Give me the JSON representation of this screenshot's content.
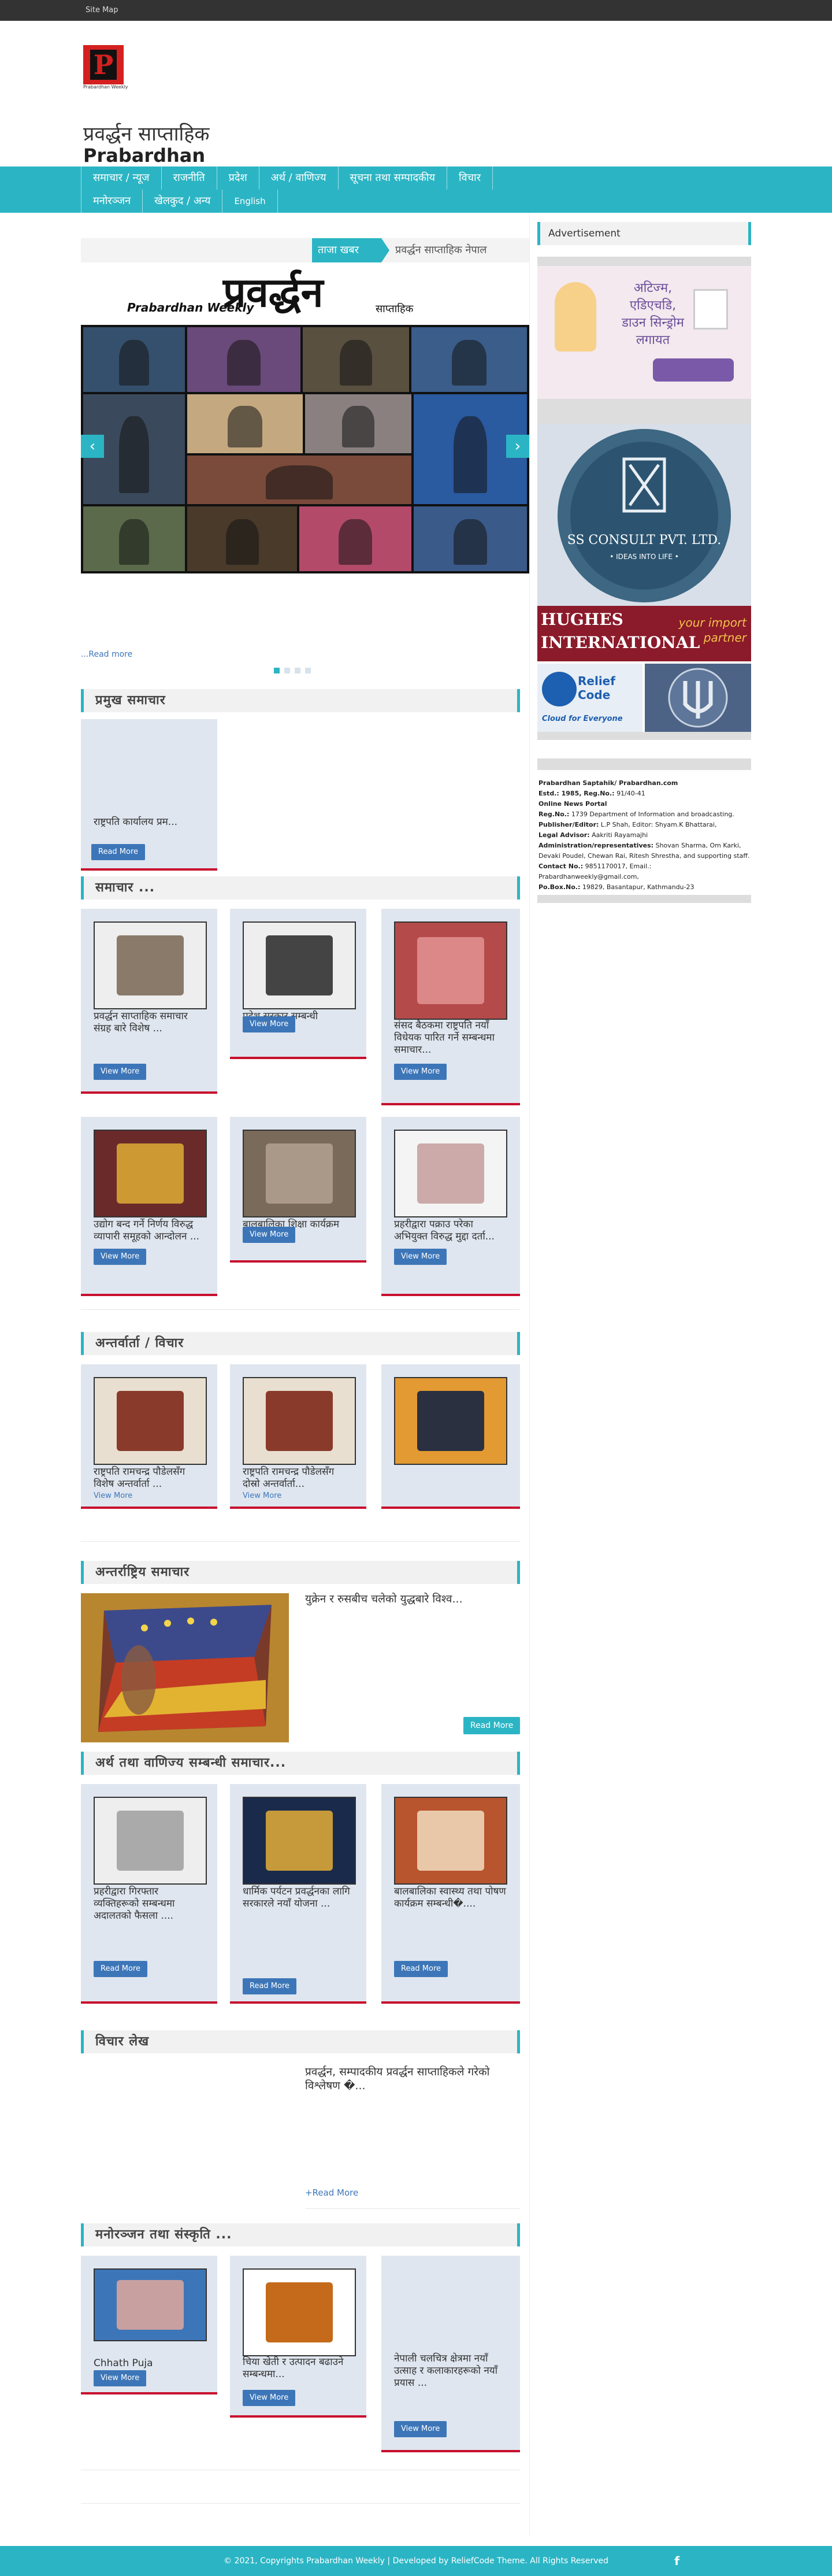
{
  "topbar": {
    "sitemap": "Site Map"
  },
  "header": {
    "logo_letter": "P",
    "logo_caption": "Prabardhan Weekly",
    "title": "प्रवर्द्धन साप्ताहिक",
    "tagline": "Prabardhan"
  },
  "nav": {
    "row1": [
      "समाचार / न्यूज",
      "राजनीति",
      "प्रदेश",
      "अर्थ / वाणिज्य",
      "सूचना तथा सम्पादकीय",
      "विचार"
    ],
    "row2": [
      "मनोरञ्जन",
      "खेलकुद / अन्य",
      "English"
    ]
  },
  "ticker": {
    "label": "ताजा खबर",
    "text": "प्रवर्द्धन साप्ताहिक नेपाल"
  },
  "slider": {
    "masthead_en": "Prabardhan Weekly",
    "masthead_np": "प्रवर्द्धन",
    "masthead_sub": "साप्ताहिक",
    "read_more": "...Read more"
  },
  "section1": {
    "title": "प्रमुख समाचार",
    "item_title": "राष्ट्रपति कार्यालय प्रम...",
    "button": "Read More"
  },
  "section2": {
    "title": "समाचार ...",
    "button": "View More",
    "items": [
      "प्रवर्द्धन साप्ताहिक समाचार संग्रह बारे विशेष ...",
      "प्रदेश सरकार सम्बन्धी समाचार...",
      "संसद बैठकमा राष्ट्रपति नयाँ विधेयक पारित गर्ने सम्बन्धमा समाचार...",
      "उद्योग बन्द गर्ने निर्णय विरुद्ध व्यापारी समूहको आन्दोलन ...",
      "बालबालिका शिक्षा कार्यक्रम सम्बन्धी...",
      "प्रहरीद्वारा पक्राउ परेका अभियुक्त विरुद्ध मुद्दा दर्ता..."
    ]
  },
  "section3": {
    "title": "अन्तर्वार्ता / विचार",
    "link": "View More",
    "items": [
      "राष्ट्रपति रामचन्द्र पौडेलसँग विशेष अन्तर्वार्ता ...",
      "राष्ट्रपति रामचन्द्र पौडेलसँग दोस्रो अन्तर्वार्ता...",
      ""
    ]
  },
  "section4": {
    "title": "अन्तर्राष्ट्रिय समाचार",
    "text": "युक्रेन र रुसबीच चलेको युद्धबारे विश्व...",
    "button": "Read More"
  },
  "section5": {
    "title": "अर्थ तथा वाणिज्य सम्बन्धी समाचार...",
    "button": "Read More",
    "items": [
      "प्रहरीद्वारा गिरफ्तार व्यक्तिहरूको सम्बन्धमा अदालतको फैसला ....",
      "धार्मिक पर्यटन प्रवर्द्धनका लागि सरकारले नयाँ योजना ...",
      "बालबालिका स्वास्थ्य तथा पोषण कार्यक्रम सम्बन्धी�...."
    ]
  },
  "section6": {
    "title": "विचार लेख",
    "text": "प्रवर्द्धन, सम्पादकीय प्रवर्द्धन साप्ताहिकले गरेको विश्लेषण �...",
    "link": "+Read More"
  },
  "section7": {
    "title": "मनोरञ्जन तथा संस्कृति ...",
    "button": "View More",
    "items": [
      "Chhath Puja Festival....",
      "चिया खेती र उत्पादन बढाउने सम्बन्धमा...",
      "नेपाली चलचित्र क्षेत्रमा नयाँ उत्साह र कलाकारहरूको नयाँ प्रयास ..."
    ]
  },
  "sidebar": {
    "ad_title": "Advertisement",
    "ad1_lines": [
      "अटिज्म,",
      "एडिएचडि,",
      "डाउन सिन्ड्रोम",
      "लगायत"
    ],
    "ad2_name": "SS CONSULT PVT. LTD.",
    "ad2_tag": "• IDEAS INTO LIFE •",
    "ad3_name": "HUGHES INTERNATIONAL",
    "ad3_tag": "your import partner",
    "ad4_name": "Relief Code",
    "ad4_tag": "Cloud for Everyone",
    "info": [
      {
        "k": "Prabardhan Saptahik/ Prabardhan.com",
        "v": ""
      },
      {
        "k": "Estd.: 1985, Reg.No.:",
        "v": "91/40-41"
      },
      {
        "k": "Online News Portal",
        "v": ""
      },
      {
        "k": "Reg.No.:",
        "v": "1739 Department of Information and broadcasting."
      },
      {
        "k": "Publisher/Editor:",
        "v": "L.P Shah, Editor: Shyam.K Bhattarai,"
      },
      {
        "k": "Legal Advisor:",
        "v": "Aakriti Rayamajhi"
      },
      {
        "k": "Administration/representatives:",
        "v": "Shovan Sharma, Om Karki, Devaki Poudel, Chewan Rai, Ritesh Shrestha, and supporting staff."
      },
      {
        "k": "Contact No.:",
        "v": "9851170017, Email.: Prabardhanweekly@gmail.com,"
      },
      {
        "k": "Po.Box.No.:",
        "v": "19829, Basantapur, Kathmandu-23"
      }
    ]
  },
  "footer": {
    "text": "© 2021, Copyrights Prabardhan Weekly | Developed by ReliefCode Theme. All Rights Reserved",
    "fb": "f"
  }
}
